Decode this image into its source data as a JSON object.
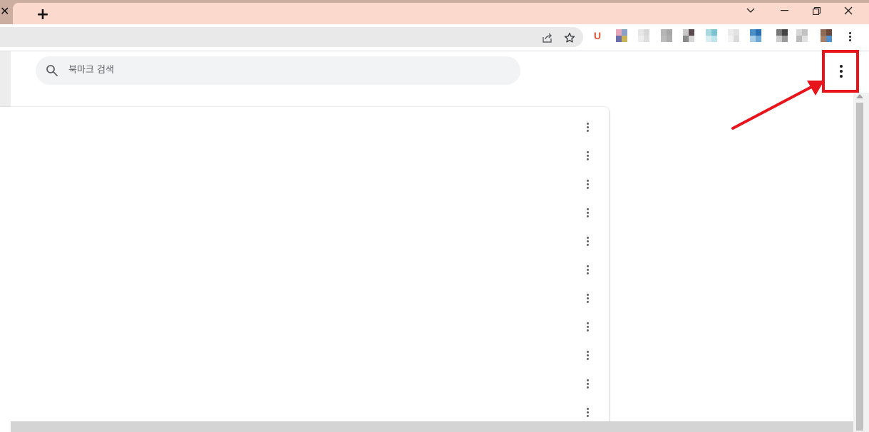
{
  "window": {
    "tab_close_glyph": "✕",
    "new_tab_glyph": "+",
    "controls": {
      "tabs_menu": "⌄",
      "minimize": "—",
      "maximize": "❐",
      "close": "✕"
    }
  },
  "toolbar": {
    "extensions": [
      {
        "name": "ext-u",
        "label": "U",
        "color": "#e0563a"
      },
      {
        "name": "ext-1",
        "colors": [
          "#e6a8b8",
          "#8a9fc9",
          "#6b6fa8",
          "#c8b35a"
        ]
      },
      {
        "name": "ext-2",
        "colors": [
          "#e6e6e6",
          "#d8d8d8",
          "#eeeeee",
          "#dedede"
        ]
      },
      {
        "name": "ext-3",
        "colors": [
          "#b5b5b5",
          "#a7a7a7",
          "#bcbcbc",
          "#adadad"
        ]
      },
      {
        "name": "ext-4",
        "colors": [
          "#c8c8c8",
          "#5b4950",
          "#8a8a8a",
          "#d6d6d6"
        ]
      },
      {
        "name": "ext-5",
        "colors": [
          "#a9d8e2",
          "#7fc3d3",
          "#d9eef3",
          "#bfe4ec"
        ]
      },
      {
        "name": "ext-6",
        "colors": [
          "#ececec",
          "#e2e2e2",
          "#f3f3f3",
          "#dadada"
        ]
      },
      {
        "name": "ext-7",
        "colors": [
          "#4a90c8",
          "#2c6fb0",
          "#a8cde8",
          "#6ea9d6"
        ]
      },
      {
        "name": "ext-8",
        "colors": [
          "#777777",
          "#444444",
          "#cccccc",
          "#999999"
        ]
      },
      {
        "name": "ext-9",
        "colors": [
          "#d6d6d6",
          "#c2c2c2",
          "#bbbbbb",
          "#e0e0e0"
        ]
      },
      {
        "name": "ext-10",
        "colors": [
          "#8e6a55",
          "#6b4a3a",
          "#a57f66",
          "#4d8fd0"
        ]
      }
    ]
  },
  "bookmarks": {
    "search_placeholder": "북마크 검색",
    "row_count": 11
  },
  "colors": {
    "titlebar": "#ccaea1",
    "tab_strip": "#fbdacd",
    "highlight": "#e8141c"
  }
}
